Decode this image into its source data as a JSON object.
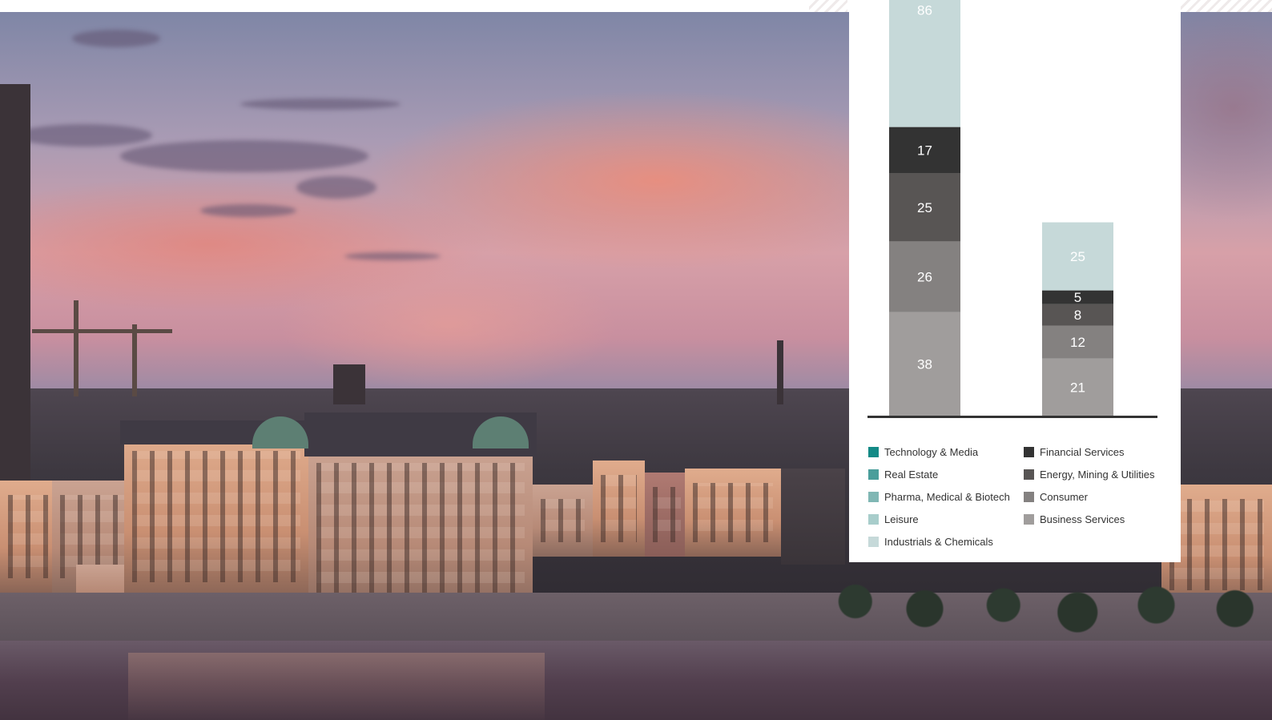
{
  "chart_data": {
    "type": "bar",
    "stacked": true,
    "categories": [
      "",
      ""
    ],
    "series": [
      {
        "name": "Business Services",
        "color": "#a09d9c",
        "values": [
          38,
          21
        ]
      },
      {
        "name": "Consumer",
        "color": "#848180",
        "values": [
          26,
          12
        ]
      },
      {
        "name": "Energy, Mining & Utilities",
        "color": "#585554",
        "values": [
          25,
          8
        ]
      },
      {
        "name": "Financial Services",
        "color": "#333333",
        "values": [
          17,
          5
        ]
      },
      {
        "name": "Industrials & Chemicals",
        "color": "#c6d9d9",
        "values": [
          86,
          25
        ]
      }
    ],
    "legend_placement": "bottom",
    "grid": false,
    "baseline": true
  },
  "legend": {
    "left": [
      {
        "label": "Technology & Media",
        "color": "#138a86"
      },
      {
        "label": "Real Estate",
        "color": "#4a9e9b"
      },
      {
        "label": "Pharma, Medical & Biotech",
        "color": "#80b7b4"
      },
      {
        "label": "Leisure",
        "color": "#a8cdcb"
      },
      {
        "label": "Industrials & Chemicals",
        "color": "#c6d9d9"
      }
    ],
    "right": [
      {
        "label": "Financial Services",
        "color": "#333333"
      },
      {
        "label": "Energy, Mining & Utilities",
        "color": "#585554"
      },
      {
        "label": "Consumer",
        "color": "#848180"
      },
      {
        "label": "Business Services",
        "color": "#a09d9c"
      }
    ]
  }
}
